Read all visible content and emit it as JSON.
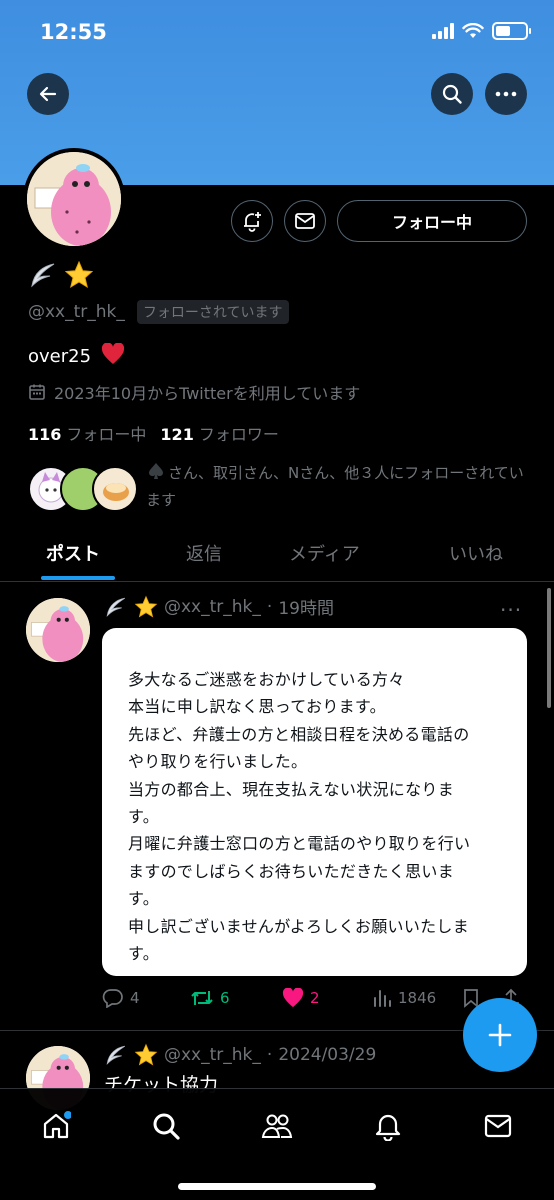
{
  "status_bar": {
    "time": "12:55"
  },
  "profile": {
    "display_name_emojis": [
      "wing",
      "star"
    ],
    "handle": "@xx_tr_hk_",
    "follows_you_label": "フォローされています",
    "bio": "over25",
    "bio_emoji": "heart",
    "joined": "2023年10月からTwitterを利用しています",
    "following_count": "116",
    "following_label": "フォロー中",
    "followers_count": "121",
    "followers_label": "フォロワー",
    "follow_button_label": "フォロー中",
    "mutuals_text": "さん、取引さん、Nさん、他３人にフォローされています"
  },
  "tabs": [
    {
      "label": "ポスト",
      "active": true
    },
    {
      "label": "返信"
    },
    {
      "label": "メディア"
    },
    {
      "label": "いいね"
    }
  ],
  "tweets": [
    {
      "handle": "@xx_tr_hk_",
      "separator": "·",
      "time": "19時間",
      "text_lines": [
        "多大なるご迷惑をおかけしている方々",
        "本当に申し訳なく思っております。",
        "先ほど、弁護士の方と相談日程を決める電話の",
        "やり取りを行いました。",
        "当方の都合上、現在支払えない状況になりま",
        "す。",
        "月曜に弁護士窓口の方と電話のやり取りを行い",
        "ますのでしばらくお待ちいただきたく思いま",
        "す。",
        "申し訳ございませんがよろしくお願いいたしま",
        "す。"
      ],
      "replies": "4",
      "retweets": "6",
      "likes": "2",
      "views": "1846"
    },
    {
      "handle": "@xx_tr_hk_",
      "separator": "·",
      "time": "2024/03/29",
      "text": "チケット協力"
    }
  ],
  "colors": {
    "accent": "#1d9bf0",
    "retweet": "#00ba7c",
    "like": "#f91880",
    "banner": "#4a9ee8"
  },
  "icons": [
    "back-arrow-icon",
    "search-icon",
    "more-icon",
    "bell-plus-icon",
    "mail-icon",
    "calendar-icon",
    "reply-icon",
    "retweet-icon",
    "heart-icon",
    "views-icon",
    "bookmark-icon",
    "share-icon",
    "plus-icon",
    "home-icon",
    "explore-icon",
    "communities-icon",
    "notifications-icon",
    "messages-icon"
  ]
}
